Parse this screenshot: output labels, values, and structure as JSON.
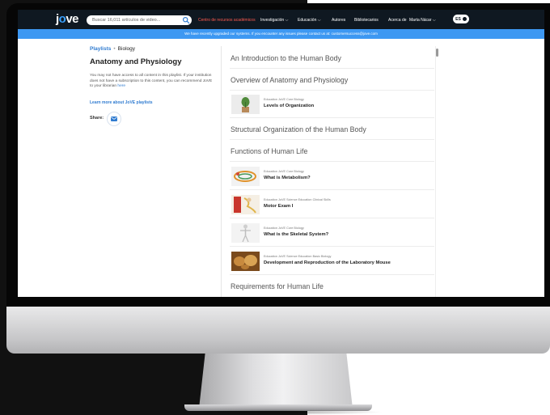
{
  "app": {
    "logo": "jove",
    "search_placeholder": "Buscar 16,011 artículos de video...",
    "nav": {
      "resource_center": "Centro de recursos académicos",
      "research": "Investigación",
      "education": "Educación",
      "authors": "Autores",
      "librarians": "Bibliotecarios",
      "about": "Acerca de",
      "user": "Marta Nácar",
      "lang": "ES"
    },
    "banner": "We have recently upgraded our systems. If you encounter any issues please contact us at: customersuccess@jove.com"
  },
  "playlist": {
    "breadcrumb_root": "Playlists",
    "breadcrumb_sep": "•",
    "breadcrumb_current": "Biology",
    "title": "Anatomy and Physiology",
    "notice": "You may not have access to all content in this playlist. If your institution does not have a subscription to this content, you can recommend JoVE to your librarian",
    "notice_link": "here",
    "learn_more": "Learn more about JoVE playlists",
    "share_label": "Share:"
  },
  "sections": [
    {
      "title": "An Introduction to the Human Body",
      "videos": []
    },
    {
      "title": "Overview of Anatomy and Physiology",
      "videos": [
        {
          "tags": "Education   JoVE Core   Biology",
          "title": "Levels of Organization",
          "thumb": "plant"
        }
      ]
    },
    {
      "title": "Structural Organization of the Human Body",
      "videos": []
    },
    {
      "title": "Functions of Human Life",
      "videos": [
        {
          "tags": "Education   JoVE Core   Biology",
          "title": "What is Metabolism?",
          "thumb": "metabolism"
        },
        {
          "tags": "Education   JoVE Science Education   Clinical Skills",
          "title": "Motor Exam I",
          "thumb": "motor"
        },
        {
          "tags": "Education   JoVE Core   Biology",
          "title": "What is the Skeletal System?",
          "thumb": "skeleton"
        },
        {
          "tags": "Education   JoVE Science Education   Basic Biology",
          "title": "Development and Reproduction of the Laboratory Mouse",
          "thumb": "mouse"
        }
      ]
    },
    {
      "title": "Requirements for Human Life",
      "videos": []
    }
  ],
  "colors": {
    "nav_bg": "#0f1821",
    "banner_bg": "#3d98f2",
    "link": "#2f7bd0",
    "nav_red": "#ff5a4e"
  }
}
